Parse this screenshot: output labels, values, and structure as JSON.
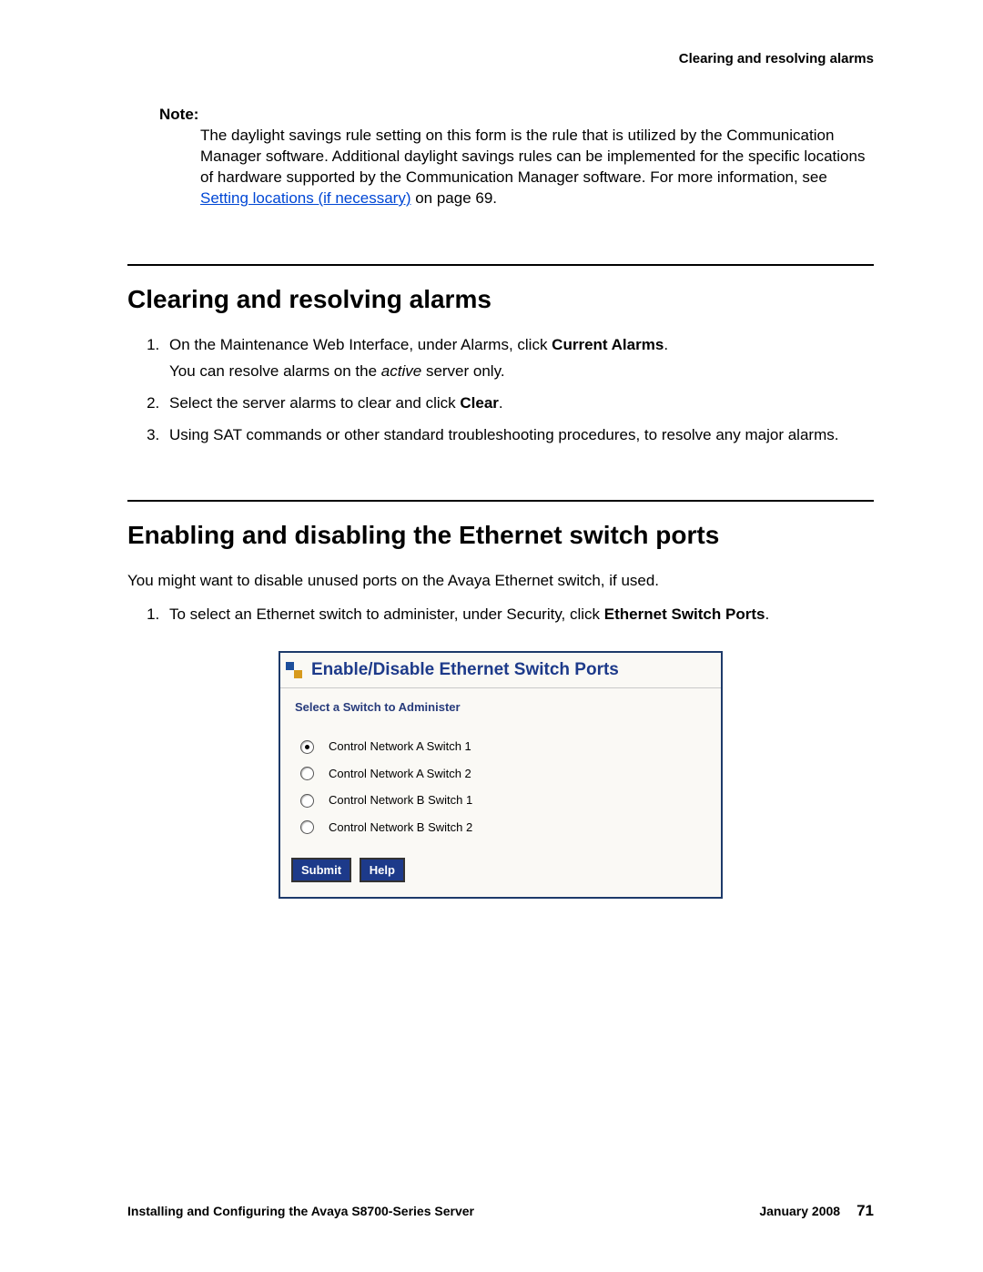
{
  "header": {
    "right": "Clearing and resolving alarms"
  },
  "note": {
    "label": "Note:",
    "body_pre": "The daylight savings rule setting on this form is the rule that is utilized by the Communication Manager software. Additional daylight savings rules can be implemented for the specific locations of hardware supported by the Communication Manager software. For more information, see ",
    "link": "Setting locations (if necessary)",
    "body_post": " on page 69."
  },
  "sections": {
    "clearing": {
      "title": "Clearing and resolving alarms",
      "steps": {
        "s1a": "On the Maintenance Web Interface, under Alarms, click ",
        "s1b": "Current Alarms",
        "s1c": ".",
        "s1sub_a": "You can resolve alarms on the ",
        "s1sub_b": "active",
        "s1sub_c": " server only.",
        "s2a": "Select the server alarms to clear and click ",
        "s2b": "Clear",
        "s2c": ".",
        "s3": "Using SAT commands or other standard troubleshooting procedures, to resolve any major alarms."
      }
    },
    "ethernet": {
      "title": "Enabling and disabling the Ethernet switch ports",
      "intro": "You might want to disable unused ports on the Avaya Ethernet switch, if used.",
      "s1a": "To select an Ethernet switch to administer, under Security, click ",
      "s1b": "Ethernet Switch Ports",
      "s1c": "."
    }
  },
  "figure": {
    "title": "Enable/Disable Ethernet Switch Ports",
    "subtitle": "Select a Switch to Administer",
    "options": {
      "o0": "Control Network A Switch 1",
      "o1": "Control Network A Switch 2",
      "o2": "Control Network B Switch 1",
      "o3": "Control Network B Switch 2"
    },
    "buttons": {
      "submit": "Submit",
      "help": "Help"
    }
  },
  "footer": {
    "left": "Installing and Configuring the Avaya S8700-Series Server",
    "date": "January 2008",
    "page": "71"
  }
}
